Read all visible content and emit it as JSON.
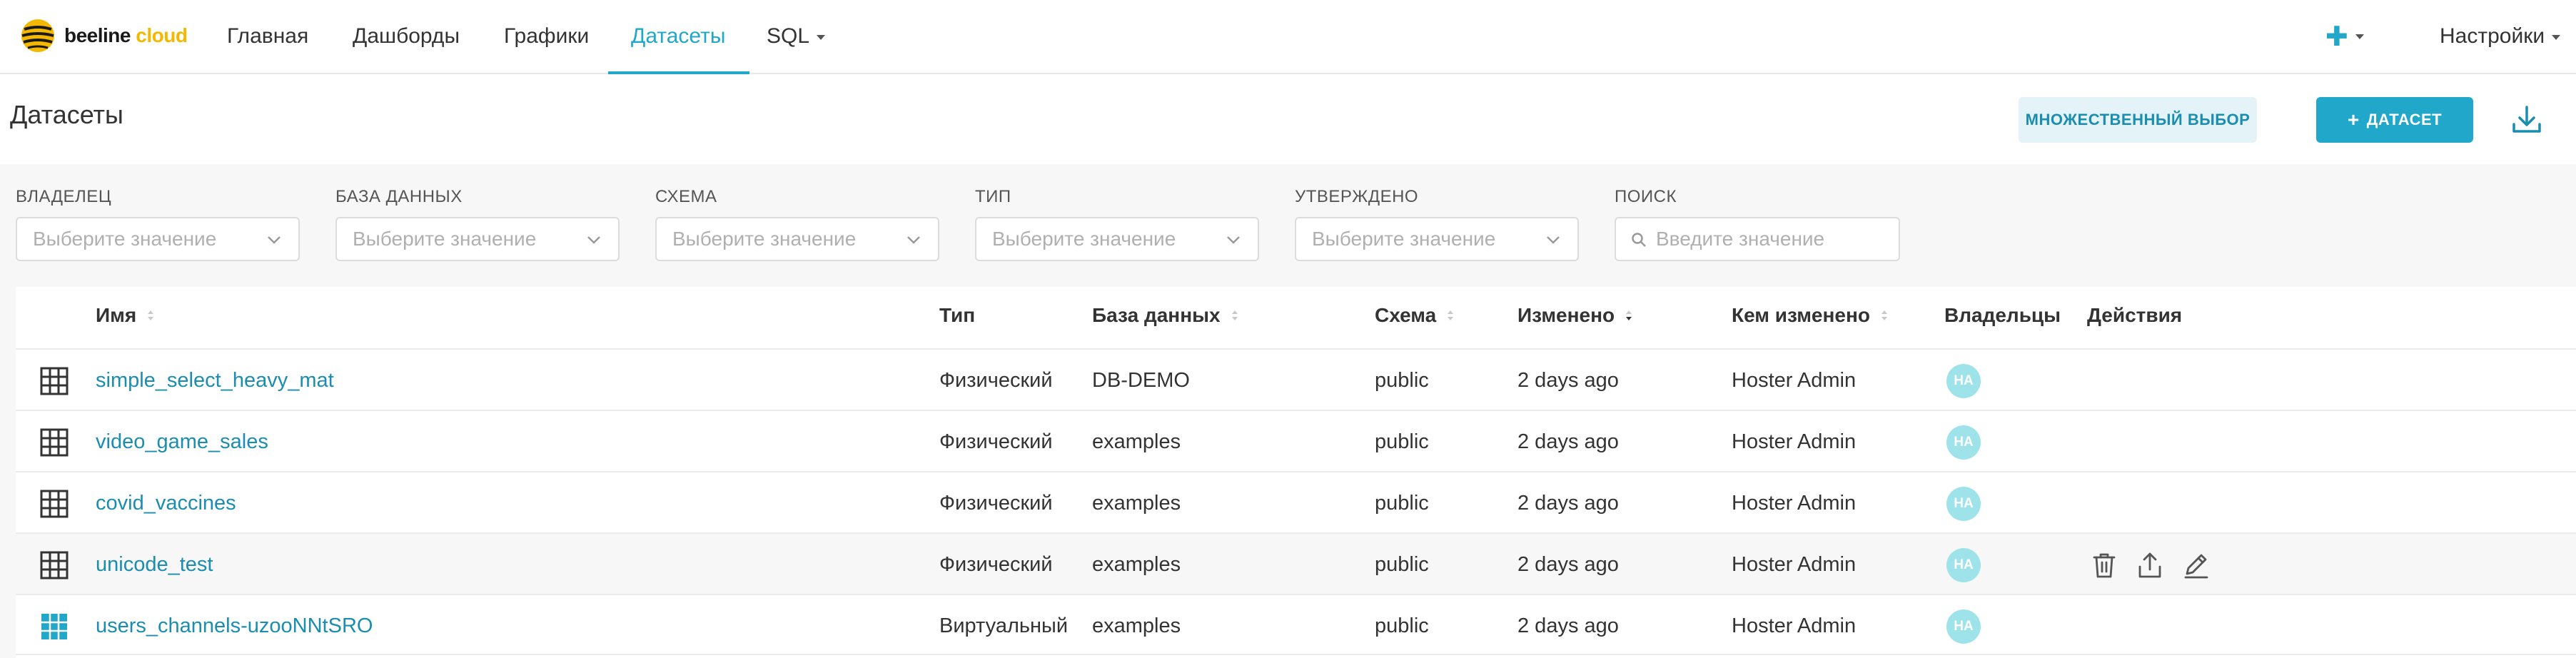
{
  "brand": {
    "name_main": "beeline",
    "name_accent": "cloud"
  },
  "nav": {
    "items": [
      "Главная",
      "Дашборды",
      "Графики",
      "Датасеты",
      "SQL"
    ],
    "active": "Датасеты",
    "settings": "Настройки"
  },
  "page": {
    "title": "Датасеты",
    "multi_select_label": "МНОЖЕСТВЕННЫЙ ВЫБОР",
    "add_dataset_label": "ДАТАСЕТ"
  },
  "filters": {
    "owner": {
      "label": "ВЛАДЕЛЕЦ",
      "placeholder": "Выберите значение"
    },
    "database": {
      "label": "БАЗА ДАННЫХ",
      "placeholder": "Выберите значение"
    },
    "schema": {
      "label": "СХЕМА",
      "placeholder": "Выберите значение"
    },
    "type": {
      "label": "ТИП",
      "placeholder": "Выберите значение"
    },
    "certified": {
      "label": "УТВЕРЖДЕНО",
      "placeholder": "Выберите значение"
    },
    "search": {
      "label": "ПОИСК",
      "placeholder": "Введите значение"
    }
  },
  "table": {
    "headers": {
      "name": "Имя",
      "type": "Тип",
      "database": "База данных",
      "schema": "Схема",
      "modified": "Изменено",
      "modified_by": "Кем изменено",
      "owners": "Владельцы",
      "actions": "Действия"
    },
    "rows": [
      {
        "name": "simple_select_heavy_mat",
        "type": "Физический",
        "database": "DB-DEMO",
        "schema": "public",
        "modified": "2 days ago",
        "modified_by": "Hoster Admin",
        "owner_initials": "HA",
        "kind": "physical"
      },
      {
        "name": "video_game_sales",
        "type": "Физический",
        "database": "examples",
        "schema": "public",
        "modified": "2 days ago",
        "modified_by": "Hoster Admin",
        "owner_initials": "HA",
        "kind": "physical"
      },
      {
        "name": "covid_vaccines",
        "type": "Физический",
        "database": "examples",
        "schema": "public",
        "modified": "2 days ago",
        "modified_by": "Hoster Admin",
        "owner_initials": "HA",
        "kind": "physical"
      },
      {
        "name": "unicode_test",
        "type": "Физический",
        "database": "examples",
        "schema": "public",
        "modified": "2 days ago",
        "modified_by": "Hoster Admin",
        "owner_initials": "HA",
        "kind": "physical"
      },
      {
        "name": "users_channels-uzooNNtSRO",
        "type": "Виртуальный",
        "database": "examples",
        "schema": "public",
        "modified": "2 days ago",
        "modified_by": "Hoster Admin",
        "owner_initials": "HA",
        "kind": "virtual"
      }
    ]
  },
  "colors": {
    "accent": "#20a7c9",
    "link": "#1b8db0",
    "avatar": "#9fe3ea",
    "brand_yellow": "#f5b800"
  }
}
